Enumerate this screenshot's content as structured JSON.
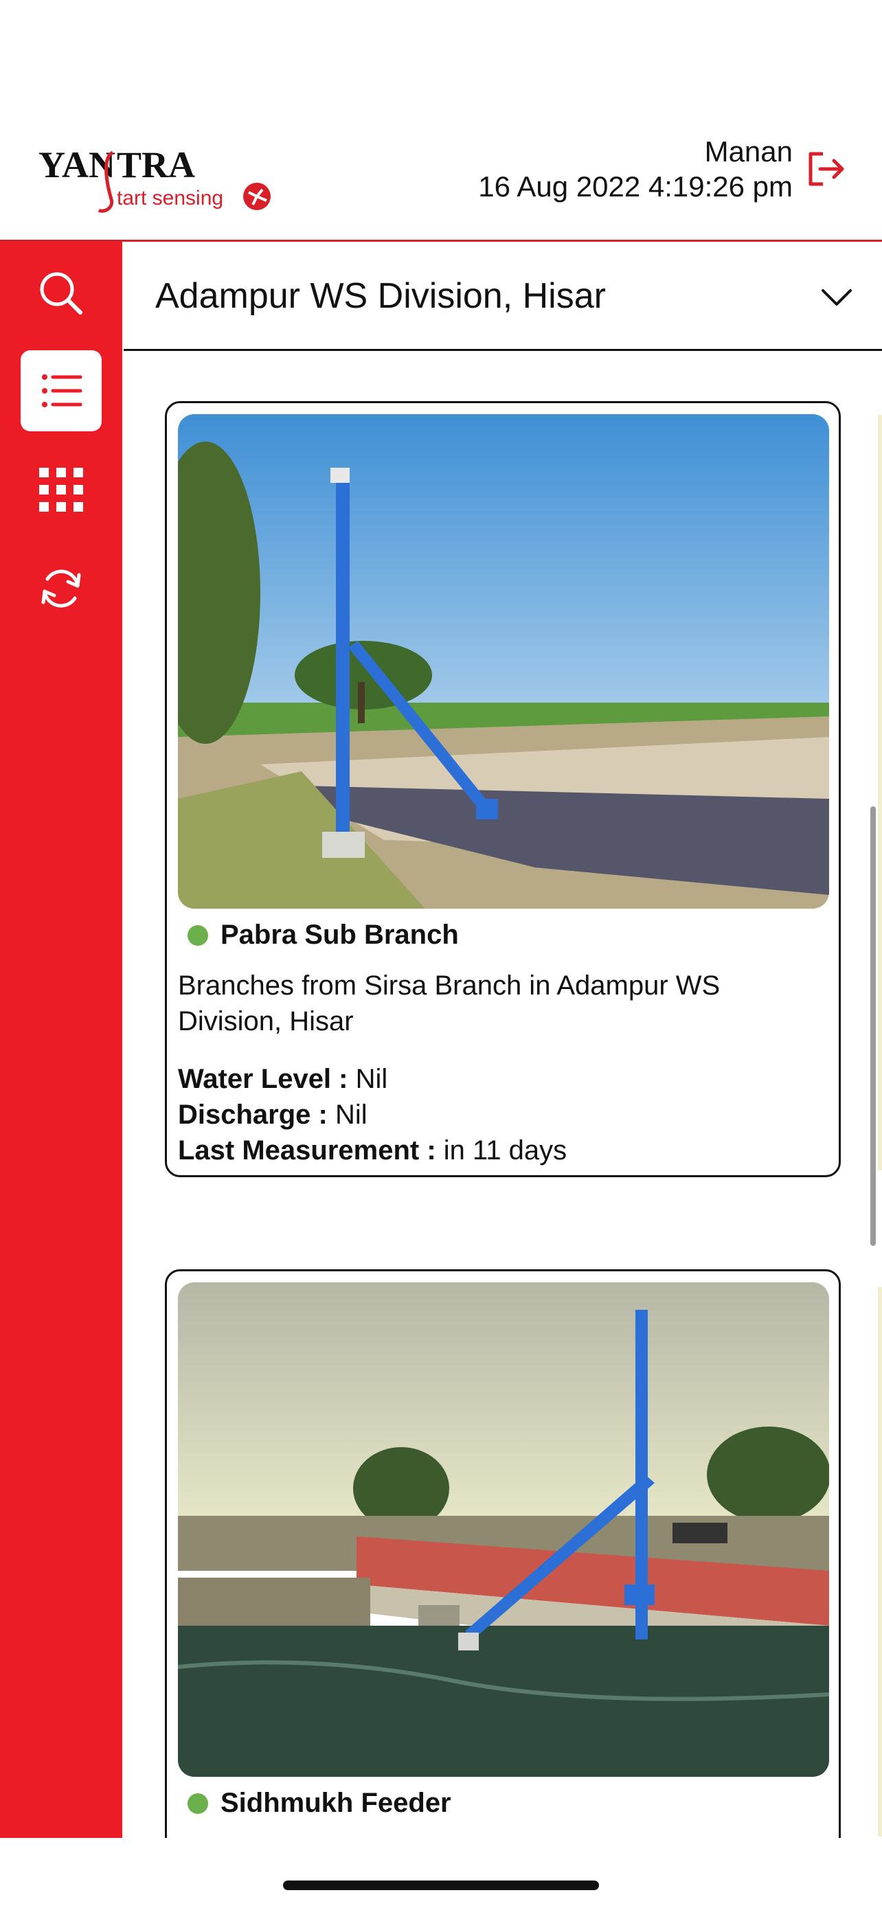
{
  "header": {
    "logo": {
      "brand": "YANSTRA",
      "tagline": "Start sensing"
    },
    "user_name": "Manan",
    "datetime": "16 Aug 2022 4:19:26 pm",
    "logout_icon": "logout-icon"
  },
  "sidebar": {
    "items": [
      {
        "name": "search",
        "icon": "search-icon",
        "active": false
      },
      {
        "name": "list",
        "icon": "list-icon",
        "active": true
      },
      {
        "name": "grid",
        "icon": "grid-icon",
        "active": false
      },
      {
        "name": "refresh",
        "icon": "refresh-icon",
        "active": false
      }
    ]
  },
  "location_select": {
    "value": "Adampur WS Division, Hisar",
    "icon": "chevron-down-icon"
  },
  "stations": [
    {
      "name": "Pabra Sub Branch",
      "status_color": "#6ab04c",
      "description": "Branches from Sirsa Branch in Adampur WS Division, Hisar",
      "water_level_label": "Water Level :",
      "water_level_value": "Nil",
      "discharge_label": "Discharge :",
      "discharge_value": "Nil",
      "last_measurement_label": "Last Measurement :",
      "last_measurement_value": "in 11 days"
    },
    {
      "name": "Sidhmukh Feeder",
      "status_color": "#6ab04c"
    }
  ],
  "colors": {
    "accent": "#ec1c27",
    "status": "#6ab04c"
  }
}
